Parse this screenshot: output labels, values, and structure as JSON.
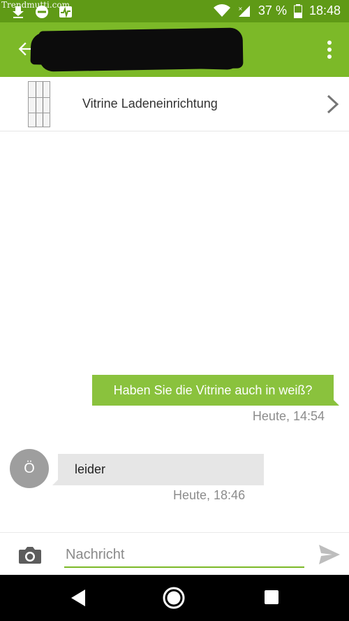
{
  "status_bar": {
    "watermark": "Trendmutti.com",
    "battery": "37 %",
    "time": "18:48"
  },
  "app_bar": {
    "title": ""
  },
  "product": {
    "title": "Vitrine Ladeneinrichtung"
  },
  "messages": [
    {
      "direction": "outgoing",
      "text": "Haben Sie die Vitrine auch in weiß?",
      "time": "Heute, 14:54"
    },
    {
      "direction": "incoming",
      "avatar": "Ö",
      "text": "leider",
      "time": "Heute, 18:46"
    }
  ],
  "input": {
    "placeholder": "Nachricht",
    "value": ""
  },
  "colors": {
    "status_bar": "#5f9a16",
    "app_bar": "#7cb928",
    "outgoing_bubble": "#8ac23d",
    "incoming_bubble": "#e6e6e6",
    "avatar": "#9e9e9e"
  },
  "icons": {
    "status_left": [
      "download-icon",
      "dnd-icon",
      "activity-icon"
    ],
    "status_right": [
      "wifi-icon",
      "signal-icon",
      "battery-icon"
    ],
    "app_bar": [
      "back-arrow-icon",
      "overflow-menu-icon"
    ],
    "product": [
      "chevron-right-icon"
    ],
    "input": [
      "camera-icon",
      "send-icon"
    ],
    "navigation": [
      "nav-back-icon",
      "nav-home-icon",
      "nav-recents-icon"
    ]
  }
}
